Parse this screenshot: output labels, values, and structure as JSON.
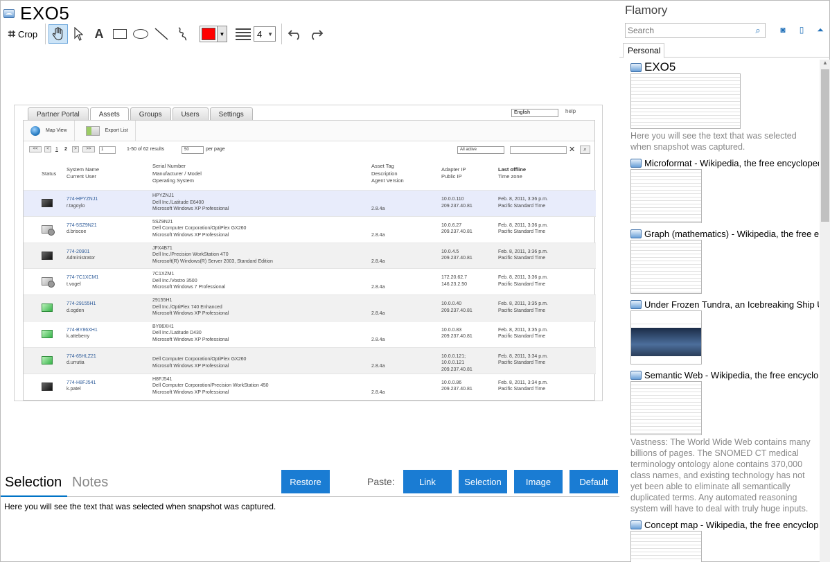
{
  "editor": {
    "doc_title": "EXO5",
    "toolbar": {
      "crop_label": "Crop",
      "text_tool": "A",
      "stroke_color": "#ff0000",
      "line_width": "4"
    }
  },
  "snapshot": {
    "tabs": [
      "Partner Portal",
      "Assets",
      "Groups",
      "Users",
      "Settings"
    ],
    "language": "English",
    "help": "help",
    "subnav": {
      "map_view": "Map View",
      "export_list": "Export List"
    },
    "pager": {
      "first": "<<",
      "prev": "<",
      "page1": "1",
      "page2": "2",
      "next": ">",
      "last": ">>",
      "goto": "1",
      "results": "1-50 of 62 results",
      "per_page_value": "50",
      "per_page_label": "per page",
      "filter": "All active"
    },
    "columns": {
      "status": "Status",
      "system_name": "System Name",
      "current_user": "Current User",
      "serial": "Serial Number",
      "manufacturer": "Manufacturer / Model",
      "os": "Operating System",
      "asset_tag": "Asset Tag",
      "description": "Description",
      "agent": "Agent Version",
      "adapter_ip": "Adapter IP",
      "public_ip": "Public IP",
      "last_offline": "Last offline",
      "timezone": "Time zone"
    },
    "rows": [
      {
        "icon": "dark",
        "name": "774-HPYZNJ1",
        "user": "r.tagoylo",
        "serial": "HPYZNJ1",
        "model": "Dell Inc./Latitude E6400",
        "os": "Microsoft Windows XP Professional",
        "agent": "2.8.4a",
        "ip1": "10.0.0.110",
        "ip2": "209.237.40.81",
        "date": "Feb. 8, 2011, 3:36 p.m.",
        "tz": "Pacific Standard Time"
      },
      {
        "icon": "clock",
        "name": "774-5SZ9N21",
        "user": "d.briscoe",
        "serial": "5SZ9N21",
        "model": "Dell Computer Corporation/OptiPlex GX260",
        "os": "Microsoft Windows XP Professional",
        "agent": "2.8.4a",
        "ip1": "10.0.6.27",
        "ip2": "209.237.40.81",
        "date": "Feb. 8, 2011, 3:36 p.m.",
        "tz": "Pacific Standard Time"
      },
      {
        "icon": "dark",
        "name": "774-20901",
        "user": "Administrator",
        "serial": "JFX4B71",
        "model": "Dell Inc./Precision WorkStation 470",
        "os": "Microsoft(R) Windows(R) Server 2003, Standard Edition",
        "agent": "2.8.4a",
        "ip1": "10.0.4.5",
        "ip2": "209.237.40.81",
        "date": "Feb. 8, 2011, 3:36 p.m.",
        "tz": "Pacific Standard Time"
      },
      {
        "icon": "clock",
        "name": "774-7C1XCM1",
        "user": "t.vogel",
        "serial": "7C1XZM1",
        "model": "Dell Inc./Vostro 3500",
        "os": "Microsoft Windows 7 Professional",
        "agent": "2.8.4a",
        "ip1": "172.20.62.7",
        "ip2": "146.23.2.50",
        "date": "Feb. 8, 2011, 3:36 p.m.",
        "tz": "Pacific Standard Time"
      },
      {
        "icon": "green",
        "name": "774-29155H1",
        "user": "d.ogden",
        "serial": "29155H1",
        "model": "Dell Inc./OptiPlex 740 Enhanced",
        "os": "Microsoft Windows XP Professional",
        "agent": "2.8.4a",
        "ip1": "10.0.0.40",
        "ip2": "209.237.40.81",
        "date": "Feb. 8, 2011, 3:35 p.m.",
        "tz": "Pacific Standard Time"
      },
      {
        "icon": "green",
        "name": "774-BY86XH1",
        "user": "k.atteberry",
        "serial": "BY86XH1",
        "model": "Dell Inc./Latitude D430",
        "os": "Microsoft Windows XP Professional",
        "agent": "2.8.4a",
        "ip1": "10.0.0.83",
        "ip2": "209.237.40.81",
        "date": "Feb. 8, 2011, 3:35 p.m.",
        "tz": "Pacific Standard Time"
      },
      {
        "icon": "green",
        "name": "774-65HLZ21",
        "user": "d.urrutia",
        "serial": "",
        "model": "Dell Computer Corporation/OptiPlex GX260",
        "os": "Microsoft Windows XP Professional",
        "agent": "2.8.4a",
        "ip1": "10.0.0.121;",
        "ip1b": "10.0.0.121",
        "ip2": "209.237.40.81",
        "date": "Feb. 8, 2011, 3:34 p.m.",
        "tz": "Pacific Standard Time"
      },
      {
        "icon": "dark",
        "name": "774-H8FJ541",
        "user": "k.patel",
        "serial": "H8FJ541",
        "model": "Dell Computer Corporation/Precision WorkStation 450",
        "os": "Microsoft Windows XP Professional",
        "agent": "2.8.4a",
        "ip1": "10.0.0.86",
        "ip2": "209.237.40.81",
        "date": "Feb. 8, 2011, 3:34 p.m.",
        "tz": "Pacific Standard Time"
      }
    ]
  },
  "bottom": {
    "tab_selection": "Selection",
    "tab_notes": "Notes",
    "restore": "Restore",
    "paste_label": "Paste:",
    "paste_link": "Link",
    "paste_selection": "Selection",
    "paste_image": "Image",
    "paste_default": "Default",
    "selected_text": "Here you will see the text that was selected when snapshot was captured."
  },
  "sidebar": {
    "brand": "Flamory",
    "search_placeholder": "Search",
    "tab_personal": "Personal",
    "items": [
      {
        "title": "EXO5",
        "thumb": "wide",
        "note": "Here you will see the text that was selected when snapshot was captured."
      },
      {
        "title": "Microformat - Wikipedia, the free encyclopedia",
        "thumb": "narrow",
        "note": ""
      },
      {
        "title": "Graph (mathematics) - Wikipedia, the free encyclopedia",
        "thumb": "narrow",
        "note": ""
      },
      {
        "title": "Under Frozen Tundra, an Icebreaking Ship Uncovers",
        "thumb": "photo",
        "note": ""
      },
      {
        "title": "Semantic Web - Wikipedia, the free encyclopedia",
        "thumb": "narrow",
        "note": "Vastness: The World Wide Web contains many billions of pages. The SNOMED CT medical terminology ontology alone contains 370,000 class names, and existing technology has not yet been able to eliminate all semantically duplicated terms. Any automated reasoning system will have to deal with truly huge inputs."
      },
      {
        "title": "Concept map - Wikipedia, the free encyclopedia",
        "thumb": "narrow",
        "note": ""
      }
    ]
  }
}
